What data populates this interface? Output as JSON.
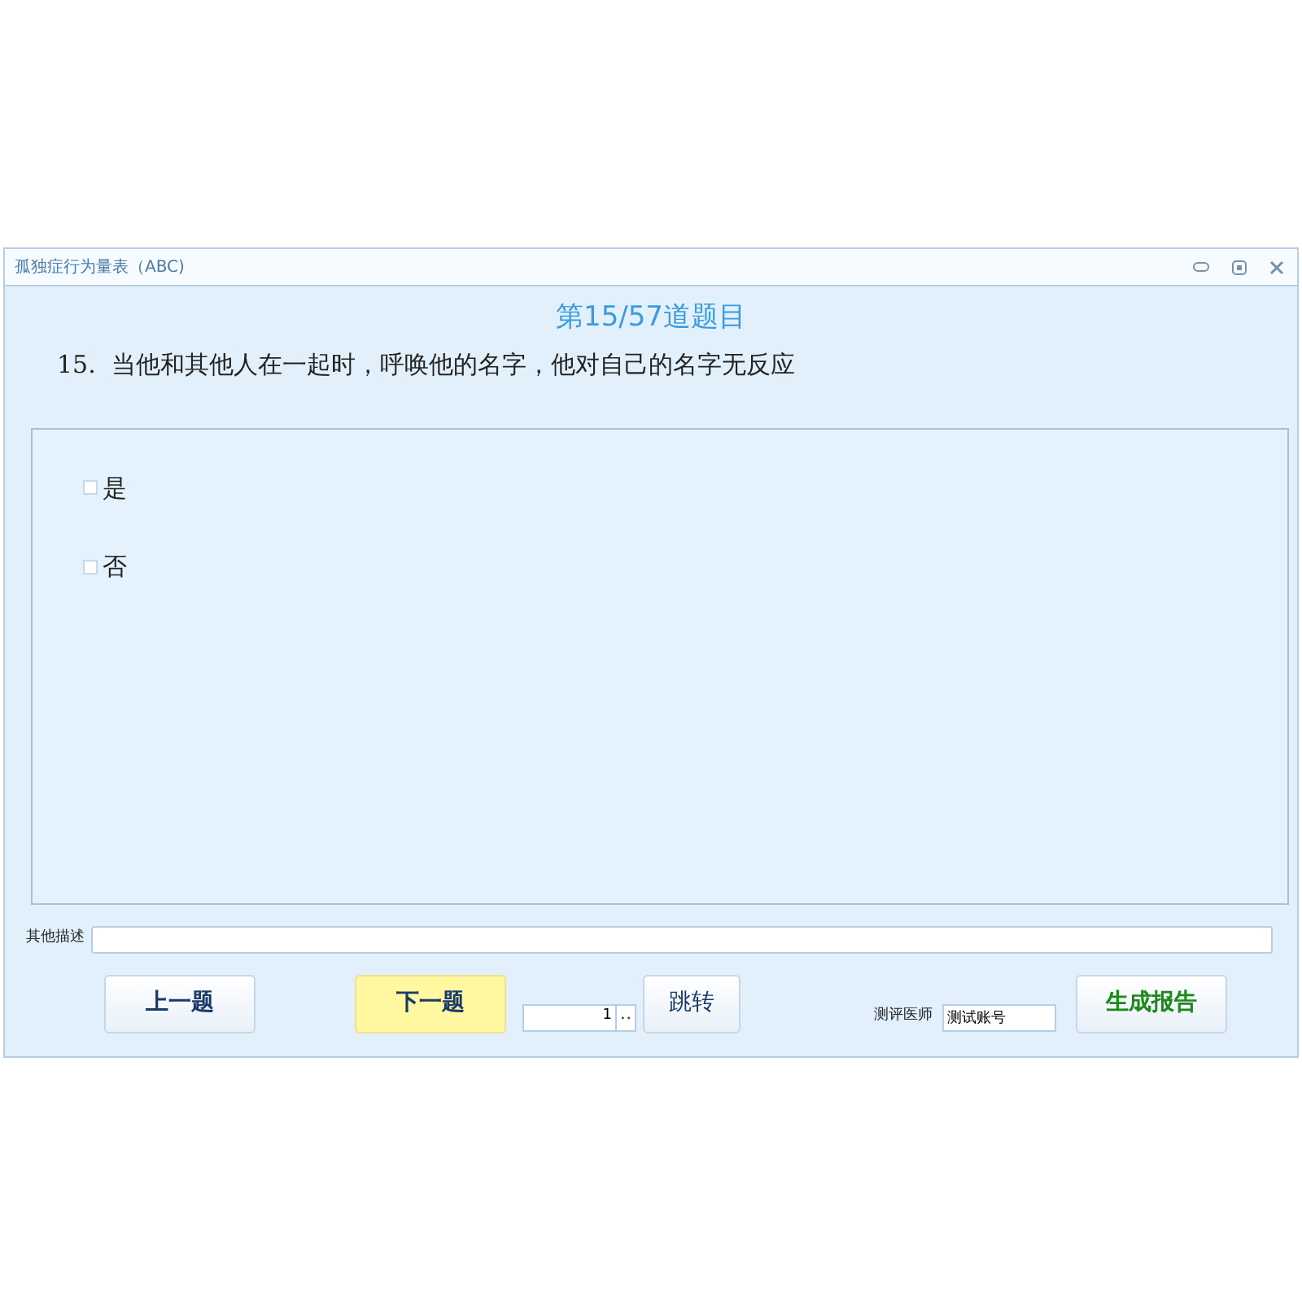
{
  "window": {
    "title": "孤独症行为量表（ABC)"
  },
  "progress": "第15/57道题目",
  "question": "15.  当他和其他人在一起时，呼唤他的名字，他对自己的名字无反应",
  "options": [
    {
      "label": "是",
      "checked": false
    },
    {
      "label": "否",
      "checked": false
    }
  ],
  "other_description": {
    "label": "其他描述"
  },
  "buttons": {
    "previous": "上一题",
    "next": "下一题",
    "jump_value": "1",
    "jump": "跳转",
    "report": "生成报告"
  },
  "evaluator": {
    "label": "测评医师",
    "value": "测试账号"
  }
}
